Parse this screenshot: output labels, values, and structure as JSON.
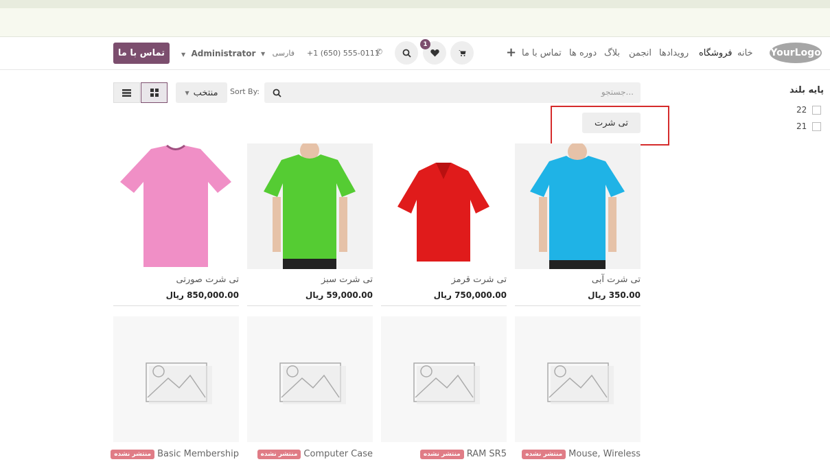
{
  "header": {
    "logo": "YourLogo",
    "nav": [
      "خانه",
      "فروشگاه",
      "بلاگ",
      "انجمن",
      "رویدادها",
      "دوره ها",
      "تماس با ما"
    ],
    "phone": "+1 (650) 555-0111",
    "language": "فارسی",
    "user": "Administrator",
    "wishlist_count": "1",
    "cta": "تماس با ما"
  },
  "toolbar": {
    "search_placeholder": "جستجو...",
    "sort_label": "Sort By:",
    "sort_value": "منتخب",
    "category_chip": "تی شرت"
  },
  "sidebar": {
    "title": "پایه بلند",
    "options": [
      "22",
      "21"
    ]
  },
  "products": [
    {
      "name": "تی شرت آبی",
      "price": "350.00 ریال",
      "color": "#1fb3e6"
    },
    {
      "name": "تی شرت قرمز",
      "price": "750,000.00 ریال",
      "color": "#e01b1b"
    },
    {
      "name": "تی شرت سبز",
      "price": "59,000.00 ریال",
      "color": "#55cc33"
    },
    {
      "name": "تی شرت صورتی",
      "price": "850,000.00 ریال",
      "color": "#f08fc6"
    },
    {
      "name": "Mouse, Wireless",
      "badge": "منتشر نشده"
    },
    {
      "name": "RAM SR5",
      "badge": "منتشر نشده"
    },
    {
      "name": "Computer Case",
      "badge": "منتشر نشده"
    },
    {
      "name": "Basic Membership",
      "badge": "منتشر نشده"
    }
  ],
  "colors": {
    "brand": "#7c4e6e",
    "highlight": "#d52b2b",
    "unpublished": "#e07c86"
  }
}
